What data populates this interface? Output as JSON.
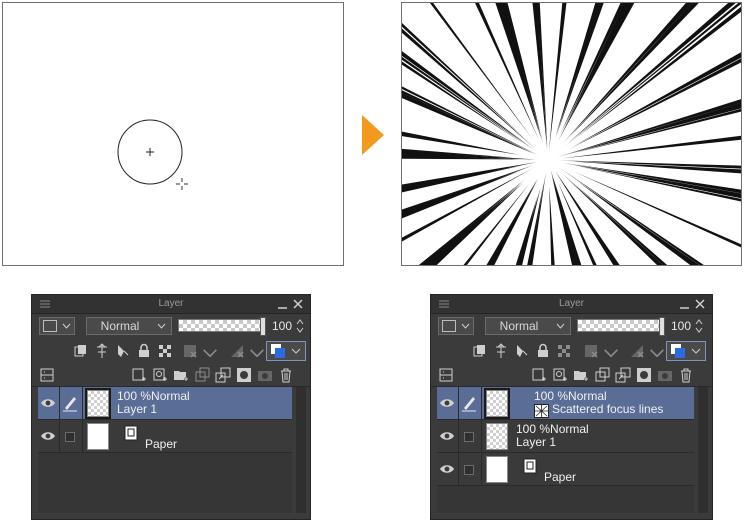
{
  "colors": {
    "accent_arrow": "#f39a1e",
    "panel_bg": "#3b3b3b",
    "selected_row": "#5a6d96",
    "canvas_border": "#6f6f6f"
  },
  "panels": [
    {
      "title": "Layer",
      "blend_mode": "Normal",
      "opacity_value": "100",
      "layers": [
        {
          "opacity_mode": "100 %Normal",
          "name": "Layer 1",
          "selected": true,
          "editing": true,
          "thumb": "transparent"
        },
        {
          "name": "Paper",
          "selected": false,
          "editing": false,
          "thumb": "white",
          "type_icon": "paper-icon"
        }
      ]
    },
    {
      "title": "Layer",
      "blend_mode": "Normal",
      "opacity_value": "100",
      "layers": [
        {
          "opacity_mode": "100 %Normal",
          "name": "Scattered focus lines",
          "selected": true,
          "editing": true,
          "thumb": "transparent",
          "type_icon": "focus-lines-icon"
        },
        {
          "opacity_mode": "100 %Normal",
          "name": "Layer 1",
          "selected": false,
          "editing": false,
          "thumb": "transparent"
        },
        {
          "name": "Paper",
          "selected": false,
          "editing": false,
          "thumb": "white",
          "type_icon": "paper-icon"
        }
      ]
    }
  ]
}
